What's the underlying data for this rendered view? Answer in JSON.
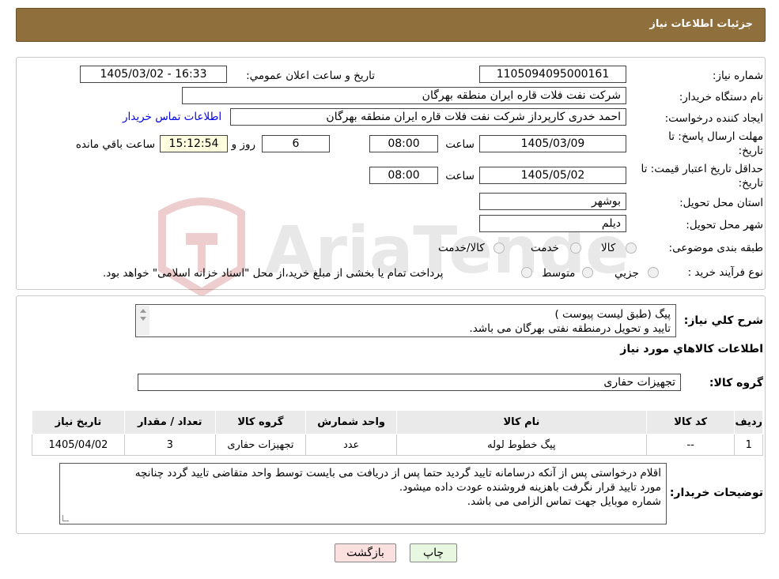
{
  "header": {
    "title": "جزئیات اطلاعات نیاز"
  },
  "form": {
    "need_number_label": "شماره نیاز:",
    "need_number": "1105094095000161",
    "announce_label": "تاریخ و ساعت اعلان عمومي:",
    "announce_value": "1405/03/02 - 16:33",
    "buyer_org_label": "نام دستگاه خريدار:",
    "buyer_org": "شرکت نفت فلات قاره ایران منطقه بهرگان",
    "creator_label": "ايجاد کننده درخواست:",
    "creator": "احمد خدری کارپرداز شرکت نفت فلات قاره ایران منطقه بهرگان",
    "contact_link": "اطلاعات تماس خريدار",
    "deadline_label_1": "مهلت ارسال پاسخ: تا",
    "deadline_label_2": "تاريخ:",
    "deadline_date": "1405/03/09",
    "time_label": "ساعت",
    "deadline_time": "08:00",
    "days": "6",
    "days_label": "روز و",
    "remaining": "15:12:54",
    "remaining_label": "ساعت باقي مانده",
    "validity_label_1": "حداقل تاريخ اعتبار قيمت: تا",
    "validity_label_2": "تاريخ:",
    "validity_date": "1405/05/02",
    "validity_time": "08:00",
    "province_label": "استان محل تحويل:",
    "province": "بوشهر",
    "city_label": "شهر محل تحويل:",
    "city": "ديلم",
    "category_label": "طبقه بندی موضوعی:",
    "category_options": [
      "کالا",
      "خدمت",
      "کالا/خدمت"
    ],
    "process_label": "نوع فرآيند خريد :",
    "process_options": [
      "جزيي",
      "متوسط"
    ],
    "process_note": "پرداخت تمام يا بخشی از مبلغ خريد،از محل \"اسناد خزانه اسلامی\" خواهد بود."
  },
  "watermark": {
    "text": "AriaTender.neT"
  },
  "details": {
    "summary_label": "شرح کلي نياز:",
    "summary_lines": [
      "پیگ (طبق لیست پیوست )",
      "تایید و تحویل درمنطقه نفتی بهرگان می باشد."
    ],
    "items_title": "اطلاعات کالاهاي مورد نياز",
    "group_label": "گروه کالا:",
    "group_value": "تجهيزات حفاری",
    "table": {
      "headers": [
        "رديف",
        "کد کالا",
        "نام کالا",
        "واحد شمارش",
        "گروه کالا",
        "تعداد / مقدار",
        "تاريخ نياز"
      ],
      "rows": [
        [
          "1",
          "--",
          "پیگ خطوط لوله",
          "عدد",
          "تجهيزات حفاری",
          "3",
          "1405/04/02"
        ]
      ]
    },
    "buyer_notes_label": "توضيحات خريدار:",
    "buyer_notes_lines": [
      "اقلام درخواستی پس از آنکه درسامانه تایید گردید حتما پس از دریافت می بایست توسط واحد متقاضی تایید گردد چنانچه",
      "مورد تایید قرار نگرفت باهزینه فروشنده عودت داده میشود.",
      "شماره موبایل جهت تماس الزامی می باشد."
    ]
  },
  "buttons": {
    "print": "چاپ",
    "back": "بازگشت"
  }
}
